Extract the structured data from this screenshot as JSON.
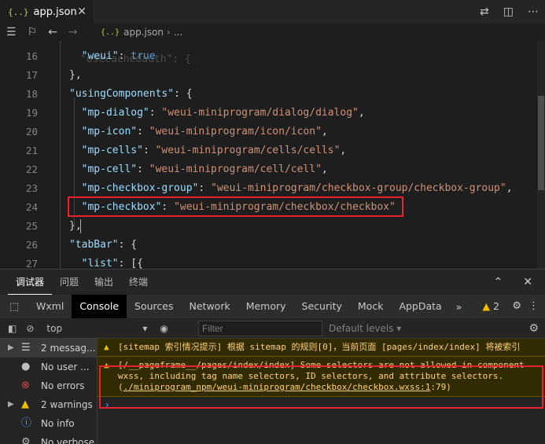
{
  "editor": {
    "tab_label": "app.json",
    "tab_icon": "{..}",
    "breadcrumb_file": "app.json",
    "breadcrumb_tail": "...",
    "top_partial_line": "\"usecachedauth\": {",
    "lines": [
      {
        "n": "16",
        "parts": [
          [
            "p",
            "  "
          ],
          [
            "k",
            "\"weui\""
          ],
          [
            "p",
            ": "
          ],
          [
            "b",
            "true"
          ]
        ]
      },
      {
        "n": "17",
        "parts": [
          [
            "p",
            "},"
          ]
        ]
      },
      {
        "n": "18",
        "parts": [
          [
            "k",
            "\"usingComponents\""
          ],
          [
            "p",
            ": {"
          ]
        ]
      },
      {
        "n": "19",
        "parts": [
          [
            "p",
            "  "
          ],
          [
            "k",
            "\"mp-dialog\""
          ],
          [
            "p",
            ": "
          ],
          [
            "s",
            "\"weui-miniprogram/dialog/dialog\""
          ],
          [
            "p",
            ","
          ]
        ]
      },
      {
        "n": "20",
        "parts": [
          [
            "p",
            "  "
          ],
          [
            "k",
            "\"mp-icon\""
          ],
          [
            "p",
            ": "
          ],
          [
            "s",
            "\"weui-miniprogram/icon/icon\""
          ],
          [
            "p",
            ","
          ]
        ]
      },
      {
        "n": "21",
        "parts": [
          [
            "p",
            "  "
          ],
          [
            "k",
            "\"mp-cells\""
          ],
          [
            "p",
            ": "
          ],
          [
            "s",
            "\"weui-miniprogram/cells/cells\""
          ],
          [
            "p",
            ","
          ]
        ]
      },
      {
        "n": "22",
        "parts": [
          [
            "p",
            "  "
          ],
          [
            "k",
            "\"mp-cell\""
          ],
          [
            "p",
            ": "
          ],
          [
            "s",
            "\"weui-miniprogram/cell/cell\""
          ],
          [
            "p",
            ","
          ]
        ]
      },
      {
        "n": "23",
        "parts": [
          [
            "p",
            "  "
          ],
          [
            "k",
            "\"mp-checkbox-group\""
          ],
          [
            "p",
            ": "
          ],
          [
            "s",
            "\"weui-miniprogram/checkbox-group/checkbox-group\""
          ],
          [
            "p",
            ","
          ]
        ]
      },
      {
        "n": "24",
        "parts": [
          [
            "p",
            "  "
          ],
          [
            "k",
            "\"mp-checkbox\""
          ],
          [
            "p",
            ": "
          ],
          [
            "s",
            "\"weui-miniprogram/checkbox/checkbox\""
          ]
        ]
      },
      {
        "n": "25",
        "parts": [
          [
            "p",
            "},"
          ]
        ]
      },
      {
        "n": "26",
        "parts": [
          [
            "k",
            "\"tabBar\""
          ],
          [
            "p",
            ": {"
          ]
        ]
      },
      {
        "n": "27",
        "parts": [
          [
            "p",
            "  "
          ],
          [
            "k",
            "\"list\""
          ],
          [
            "p",
            ": [{"
          ]
        ]
      }
    ]
  },
  "panel": {
    "tabs": [
      "调试器",
      "问题",
      "输出",
      "终端"
    ],
    "devtools_tabs": [
      "Wxml",
      "Console",
      "Sources",
      "Network",
      "Memory",
      "Security",
      "Mock",
      "AppData"
    ],
    "more": "»",
    "warning_badge": "2",
    "context": "top",
    "filter_placeholder": "Filter",
    "levels": "Default levels ▾",
    "sidebar": [
      {
        "label": "2 messag...",
        "icon": "list-icon"
      },
      {
        "label": "No user ...",
        "icon": "user-icon"
      },
      {
        "label": "No errors",
        "icon": "error-icon"
      },
      {
        "label": "2 warnings",
        "icon": "warning-icon"
      },
      {
        "label": "No info",
        "icon": "info-icon"
      },
      {
        "label": "No verbose",
        "icon": "verbose-icon"
      }
    ],
    "messages": [
      {
        "text": "[sitemap 索引情况提示] 根据 sitemap 的规则[0]，当前页面 [pages/index/index] 将被索引"
      },
      {
        "text": "[/__pageframe__/pages/index/index] Some selectors are not allowed in component wxss, including tag name selectors, ID selectors, and attribute selectors.(",
        "link": "./miniprogram_npm/weui-miniprogram/checkbox/checkbox.wxss:1",
        "tail": ":79)"
      }
    ],
    "prompt": "›"
  },
  "colors": {
    "highlight": "#e8232d",
    "warning": "#f0c000"
  }
}
